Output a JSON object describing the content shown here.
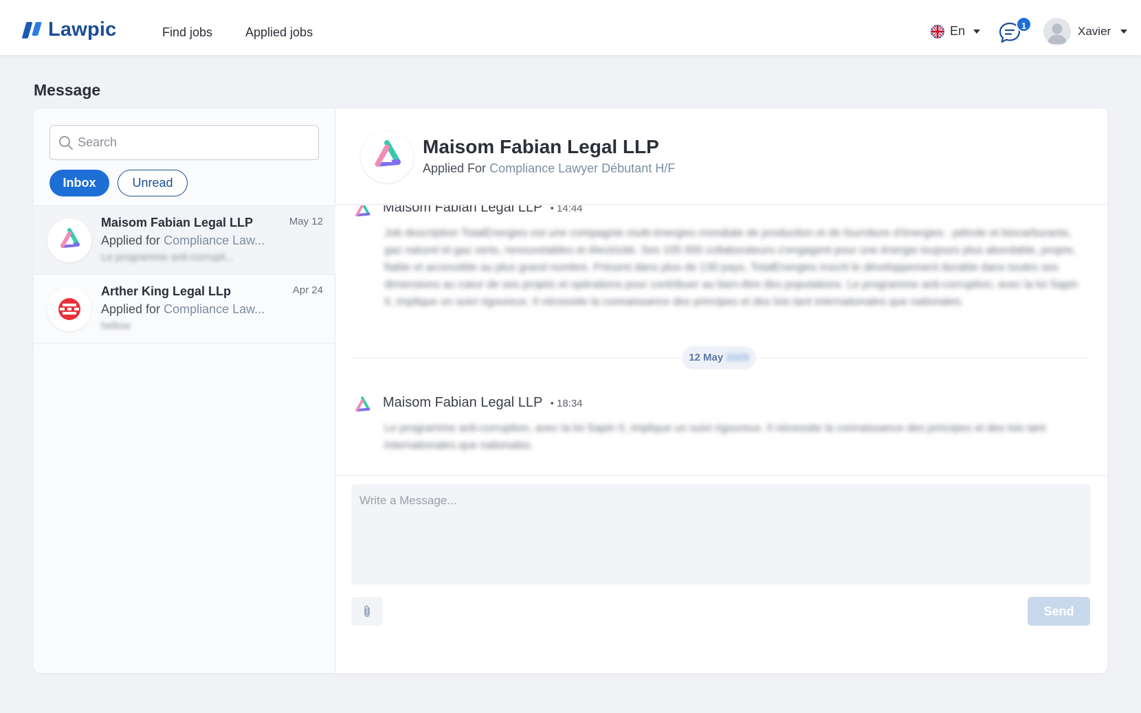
{
  "app": {
    "logo_text": "Lawpic"
  },
  "nav": {
    "find_jobs": "Find jobs",
    "applied_jobs": "Applied jobs"
  },
  "header": {
    "language": "En",
    "notification_count": "1",
    "user_name": "Xavier"
  },
  "page": {
    "title": "Message"
  },
  "sidebar": {
    "search_placeholder": "Search",
    "filters": {
      "inbox": "Inbox",
      "unread": "Unread"
    },
    "conversations": [
      {
        "name": "Maisom Fabian Legal LLP",
        "date": "May 12",
        "applied_prefix": "Applied for",
        "job": "Compliance Law...",
        "preview": "Le programme anti-corrupti..."
      },
      {
        "name": "Arther King Legal LLp",
        "date": "Apr 24",
        "applied_prefix": "Applied for",
        "job": "Compliance Law...",
        "preview": "hellow"
      }
    ]
  },
  "thread": {
    "company": "Maisom Fabian Legal LLP",
    "applied_prefix": "Applied For",
    "job": "Compliance Lawyer Débutant H/F",
    "date_separator": {
      "day": "12 May",
      "year": "2025"
    },
    "messages": [
      {
        "sender": "Maisom Fabian Legal LLP",
        "time": "14:44",
        "body": "Job description TotalEnergies est une compagnie multi-énergies mondiale de production et de fourniture d'énergies : pétrole et biocarburants, gaz naturel et gaz verts, renouvelables et électricité. Ses 105 000 collaborateurs s'engagent pour une énergie toujours plus abordable, propre, fiable et accessible au plus grand nombre. Présent dans plus de 130 pays, TotalEnergies inscrit le développement durable dans toutes ses dimensions au cœur de ses projets et opérations pour contribuer au bien-être des populations. Le programme anti-corruption, avec la loi Sapin II, implique un suivi rigoureux. Il nécessite la connaissance des principes et des lois tant internationales que nationales."
      },
      {
        "sender": "Maisom Fabian Legal LLP",
        "time": "18:34",
        "body": "Le programme anti-corruption, avec la loi Sapin II, implique un suivi rigoureux. Il nécessite la connaissance des principes et des lois tant internationales que nationales."
      }
    ]
  },
  "composer": {
    "placeholder": "Write a Message...",
    "send_label": "Send"
  },
  "colors": {
    "primary": "#1d6fd6",
    "brand_dark": "#1c4e98",
    "send_disabled": "#c9d9ed"
  }
}
